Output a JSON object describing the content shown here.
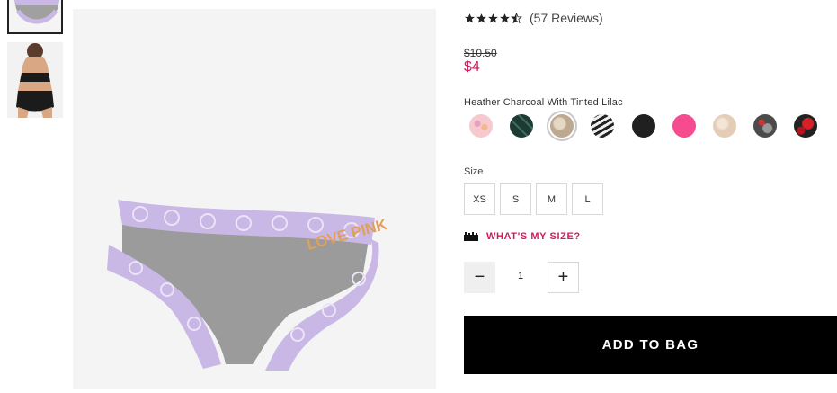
{
  "thumbnails": [
    {
      "alt": "lavender lace cheekster thumbnail",
      "selected": true
    },
    {
      "alt": "model back view in black lace",
      "selected": false
    }
  ],
  "product": {
    "rating": 4.5,
    "reviews_label": "(57 Reviews)",
    "old_price": "$10.50",
    "new_price": "$4",
    "color_name": "Heather Charcoal With Tinted Lilac",
    "image_text": "LOVE PINK"
  },
  "swatches": [
    {
      "name": "pink-floral-print",
      "color": "#f6c9cf"
    },
    {
      "name": "dark-green-plaid",
      "color": "#1f3a32"
    },
    {
      "name": "heather-charcoal-lilac",
      "color": "#cdbfae",
      "selected": true
    },
    {
      "name": "black-white-stripe",
      "color": "#6b6b6b"
    },
    {
      "name": "black",
      "color": "#202020"
    },
    {
      "name": "hot-pink",
      "color": "#f64b8f"
    },
    {
      "name": "nude-lace",
      "color": "#e9d5c2"
    },
    {
      "name": "grey-red-camo",
      "color": "#4b4b4b"
    },
    {
      "name": "black-red-print",
      "color": "#222222"
    }
  ],
  "size": {
    "label": "Size",
    "options": [
      "XS",
      "S",
      "M",
      "L"
    ],
    "guide_label": "WHAT'S MY SIZE?"
  },
  "quantity": {
    "value": "1",
    "minus": "−",
    "plus": "+"
  },
  "cta": {
    "add_to_bag": "ADD TO BAG"
  },
  "colors": {
    "accent": "#d4185f",
    "cta_bg": "#000000",
    "lace": "#c9b8e6",
    "heather": "#9b9b9b"
  }
}
